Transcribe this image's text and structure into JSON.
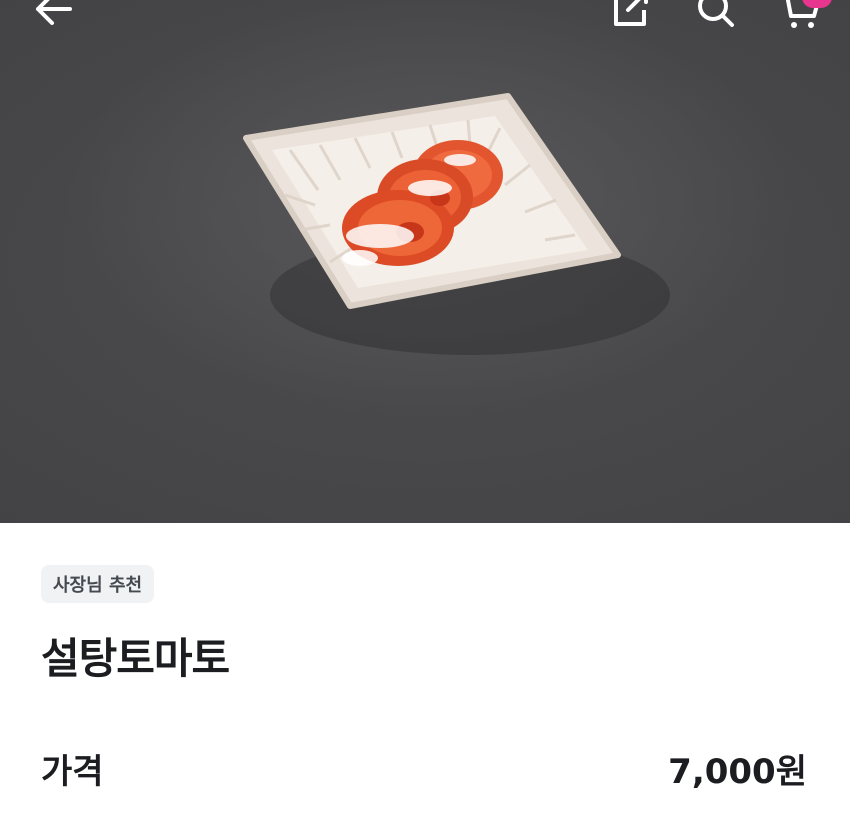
{
  "topbar": {
    "back_icon": "arrow-left-icon",
    "share_icon": "share-icon",
    "search_icon": "search-icon",
    "cart_icon": "cart-icon",
    "cart_badge_color": "#e8358e"
  },
  "product": {
    "image_description_icon": "product-photo",
    "badge": "사장님 추천",
    "name": "설탕토마토",
    "price_label": "가격",
    "price": "7,000원"
  },
  "colors": {
    "photo_background": "#48484a",
    "accent": "#e8358e",
    "text": "#1b1d20",
    "badge_bg": "#f1f2f4"
  }
}
